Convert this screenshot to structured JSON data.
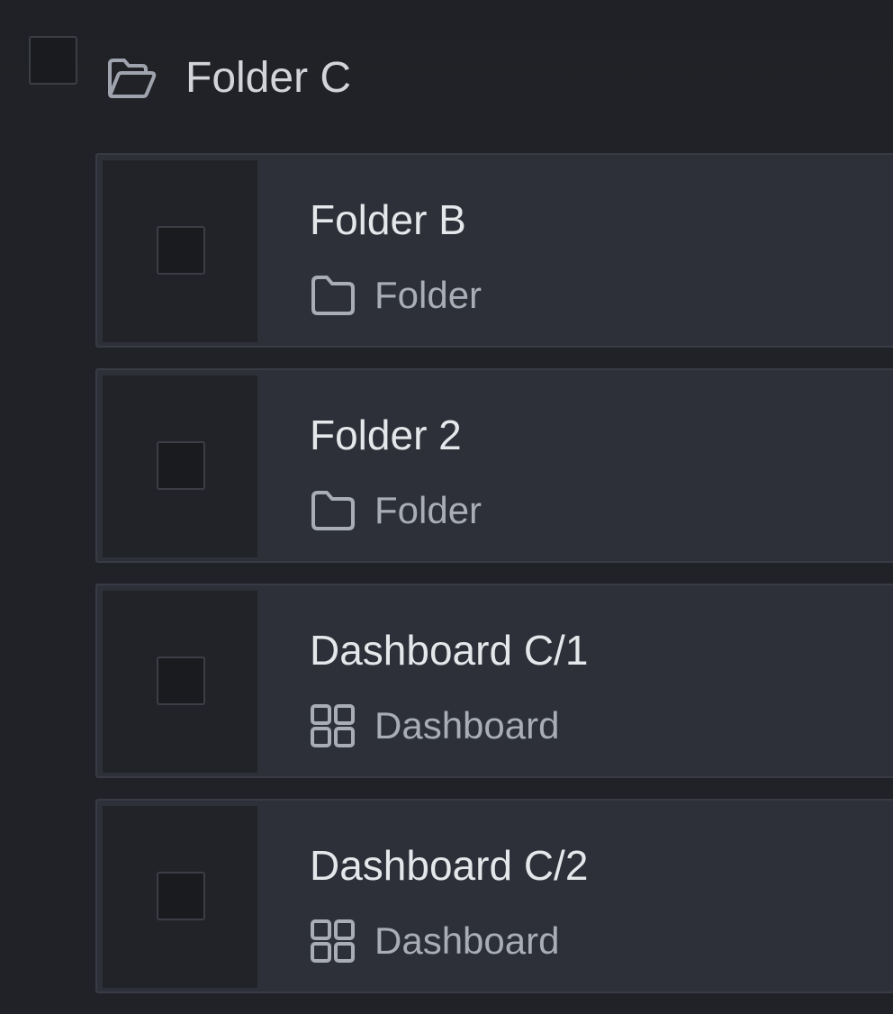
{
  "header": {
    "title": "Folder C",
    "icon": "folder-open-icon"
  },
  "items": [
    {
      "title": "Folder B",
      "type": "Folder",
      "icon": "folder-icon"
    },
    {
      "title": "Folder 2",
      "type": "Folder",
      "icon": "folder-icon"
    },
    {
      "title": "Dashboard C/1",
      "type": "Dashboard",
      "icon": "dashboard-icon"
    },
    {
      "title": "Dashboard C/2",
      "type": "Dashboard",
      "icon": "dashboard-icon"
    }
  ],
  "colors": {
    "background": "#202227",
    "row": "#2d3038",
    "text_primary": "#e5e7eb",
    "text_secondary": "#a8adb8"
  }
}
